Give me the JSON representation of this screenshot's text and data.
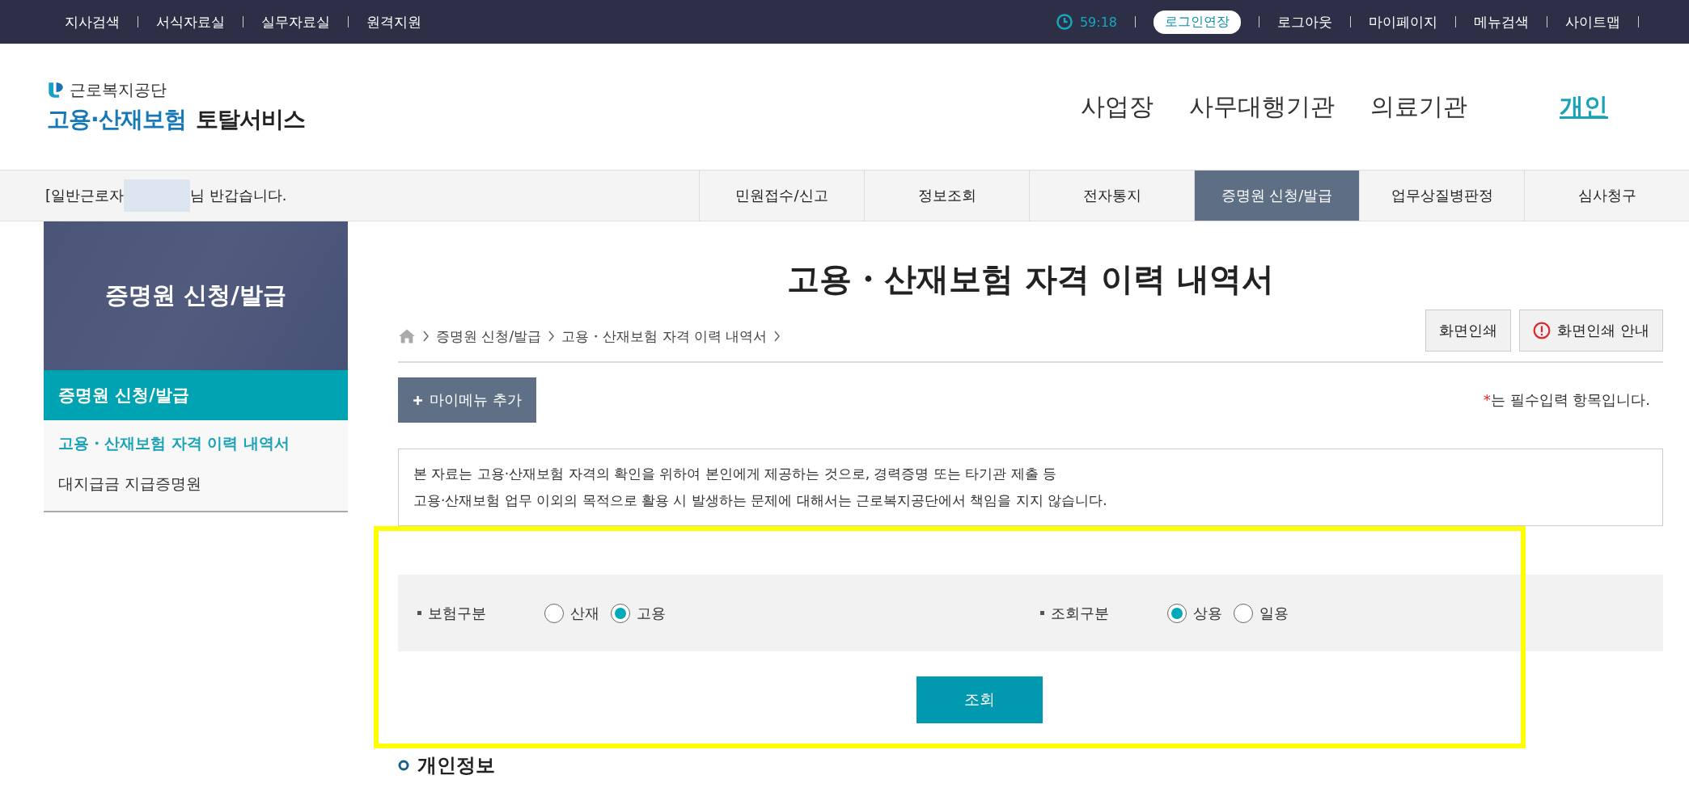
{
  "top_bar": {
    "left_links": [
      "지사검색",
      "서식자료실",
      "실무자료실",
      "원격지원"
    ],
    "timer": "59:18",
    "extend_button": "로그인연장",
    "right_links": [
      "로그아웃",
      "마이페이지",
      "메뉴검색",
      "사이트맵"
    ]
  },
  "logo": {
    "org": "근로복지공단",
    "service_main": "고용·산재보험",
    "service_sub": "토탈서비스"
  },
  "main_nav": [
    {
      "label": "사업장",
      "selected": false
    },
    {
      "label": "사무대행기관",
      "selected": false
    },
    {
      "label": "의료기관",
      "selected": false
    },
    {
      "label": "개인",
      "selected": true
    }
  ],
  "greeting": {
    "prefix": "[일반근로자",
    "suffix": "님 반갑습니다."
  },
  "tabs": [
    {
      "label": "민원접수/신고",
      "selected": false
    },
    {
      "label": "정보조회",
      "selected": false
    },
    {
      "label": "전자통지",
      "selected": false
    },
    {
      "label": "증명원 신청/발급",
      "selected": true
    },
    {
      "label": "업무상질병판정",
      "selected": false
    },
    {
      "label": "심사청구",
      "selected": false
    }
  ],
  "sidebar": {
    "title": "증명원 신청/발급",
    "section": "증명원 신청/발급",
    "items": [
      {
        "label": "고용・산재보험 자격 이력 내역서",
        "selected": true
      },
      {
        "label": "대지급금 지급증명원",
        "selected": false
      }
    ]
  },
  "page_title": "고용・산재보험 자격 이력 내역서",
  "breadcrumb": [
    "증명원 신청/발급",
    "고용・산재보험 자격 이력 내역서"
  ],
  "print_buttons": [
    {
      "label": "화면인쇄",
      "kind": "plain"
    },
    {
      "label": "화면인쇄 안내",
      "kind": "info"
    }
  ],
  "mymenu_button": "마이메뉴 추가",
  "required_note": {
    "mark": "*",
    "text": "는 필수입력 항목입니다."
  },
  "notice": [
    "본 자료는 고용·산재보험 자격의 확인을 위하여 본인에게 제공하는 것으로, 경력증명 또는 타기관 제출 등",
    "고용·산재보험 업무 이외의 목적으로 활용 시 발생하는 문제에 대해서는 근로복지공단에서 책임을 지지 않습니다."
  ],
  "form": {
    "fields": [
      {
        "label": "보험구분",
        "options": [
          {
            "label": "산재",
            "selected": false
          },
          {
            "label": "고용",
            "selected": true
          }
        ]
      },
      {
        "label": "조회구분",
        "options": [
          {
            "label": "상용",
            "selected": true
          },
          {
            "label": "일용",
            "selected": false
          }
        ]
      }
    ],
    "search_button": "조회"
  },
  "section_heading": "개인정보"
}
